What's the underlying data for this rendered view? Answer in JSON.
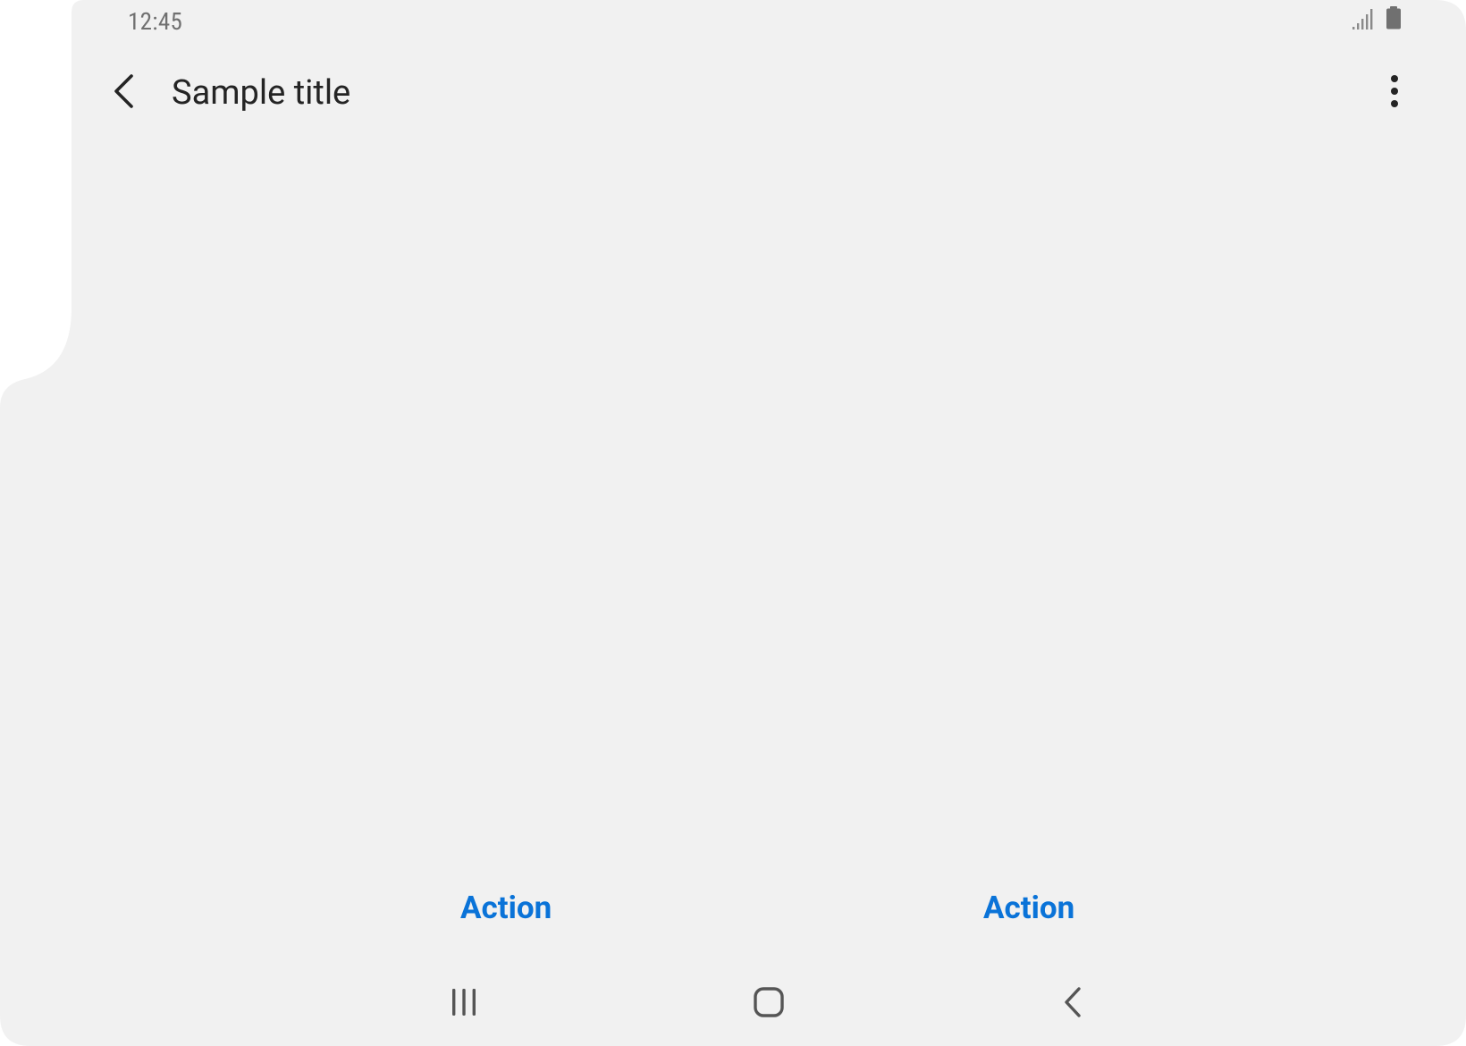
{
  "status_bar": {
    "time": "12:45",
    "icons": [
      "signal-icon",
      "battery-icon"
    ]
  },
  "app_bar": {
    "back_icon": "chevron-left-icon",
    "title": "Sample title",
    "more_icon": "more-vert-icon"
  },
  "actions": {
    "left_label": "Action",
    "right_label": "Action"
  },
  "nav_bar": {
    "recents_icon": "recents-icon",
    "home_icon": "home-icon",
    "back_icon": "back-icon"
  },
  "colors": {
    "background": "#f1f1f1",
    "action": "#0a73d8",
    "title": "#242424",
    "status": "#707070"
  }
}
